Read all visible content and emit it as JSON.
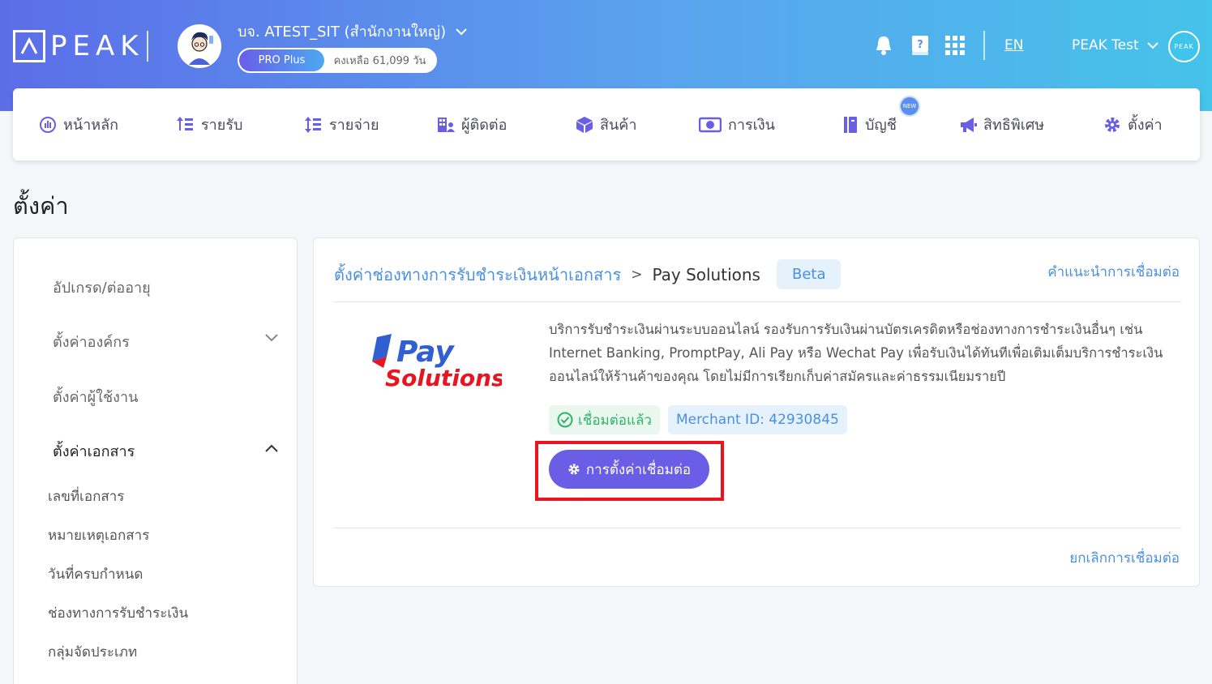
{
  "header": {
    "logo_text": "PEAK",
    "company_name": "บจ. ATEST_SIT (สำนักงานใหญ่)",
    "plan_name": "PRO Plus",
    "plan_remaining": "คงเหลือ 61,099 วัน",
    "language": "EN",
    "user_name": "PEAK Test",
    "user_avatar_text": "PEAK",
    "icons": [
      "bell-icon",
      "help-book-icon",
      "apps-grid-icon"
    ]
  },
  "nav": {
    "items": [
      {
        "label": "หน้าหลัก",
        "icon": "dashboard-icon"
      },
      {
        "label": "รายรับ",
        "icon": "income-icon"
      },
      {
        "label": "รายจ่าย",
        "icon": "expense-icon"
      },
      {
        "label": "ผู้ติดต่อ",
        "icon": "contacts-icon"
      },
      {
        "label": "สินค้า",
        "icon": "product-box-icon"
      },
      {
        "label": "การเงิน",
        "icon": "money-icon"
      },
      {
        "label": "บัญชี",
        "icon": "ledger-icon"
      },
      {
        "label": "สิทธิพิเศษ",
        "icon": "megaphone-icon"
      },
      {
        "label": "ตั้งค่า",
        "icon": "gear-icon"
      }
    ],
    "new_badge": "NEW"
  },
  "page": {
    "title": "ตั้งค่า"
  },
  "sidebar": {
    "items": [
      {
        "label": "อัปเกรด/ต่ออายุ"
      },
      {
        "label": "ตั้งค่าองค์กร"
      },
      {
        "label": "ตั้งค่าผู้ใช้งาน"
      },
      {
        "label": "ตั้งค่าเอกสาร"
      }
    ],
    "sub_items": [
      {
        "label": "เลขที่เอกสาร"
      },
      {
        "label": "หมายเหตุเอกสาร"
      },
      {
        "label": "วันที่ครบกำหนด"
      },
      {
        "label": "ช่องทางการรับชำระเงิน"
      },
      {
        "label": "กลุ่มจัดประเภท"
      }
    ]
  },
  "card": {
    "breadcrumb_parent": "ตั้งค่าช่องทางการรับชำระเงินหน้าเอกสาร",
    "breadcrumb_separator": ">",
    "breadcrumb_current": "Pay Solutions",
    "beta_label": "Beta",
    "guide_link": "คำแนะนำการเชื่อมต่อ",
    "logo_word1": "Pay",
    "logo_word2": "Solutions",
    "description": "บริการรับชำระเงินผ่านระบบออนไลน์ รองรับการรับเงินผ่านบัตรเครดิตหรือช่องทางการชำระเงินอื่นๆ เช่น Internet Banking, PromptPay, Ali Pay หรือ Wechat Pay เพื่อรับเงินได้ทันทีเพื่อเติมเต็มบริการชำระเงินออนไลน์ให้ร้านค้าของคุณ โดยไม่มีการเรียกเก็บค่าสมัครและค่าธรรมเนียมรายปี",
    "status_connected": "เชื่อมต่อแล้ว",
    "merchant_id": "Merchant ID: 42930845",
    "settings_button": "การตั้งค่าเชื่อมต่อ",
    "cancel_link": "ยกเลิกการเชื่อมต่อ"
  },
  "colors": {
    "primary": "#6b5ee6",
    "link": "#4a90e2",
    "success": "#2fb36b",
    "highlight": "#e8141f"
  }
}
